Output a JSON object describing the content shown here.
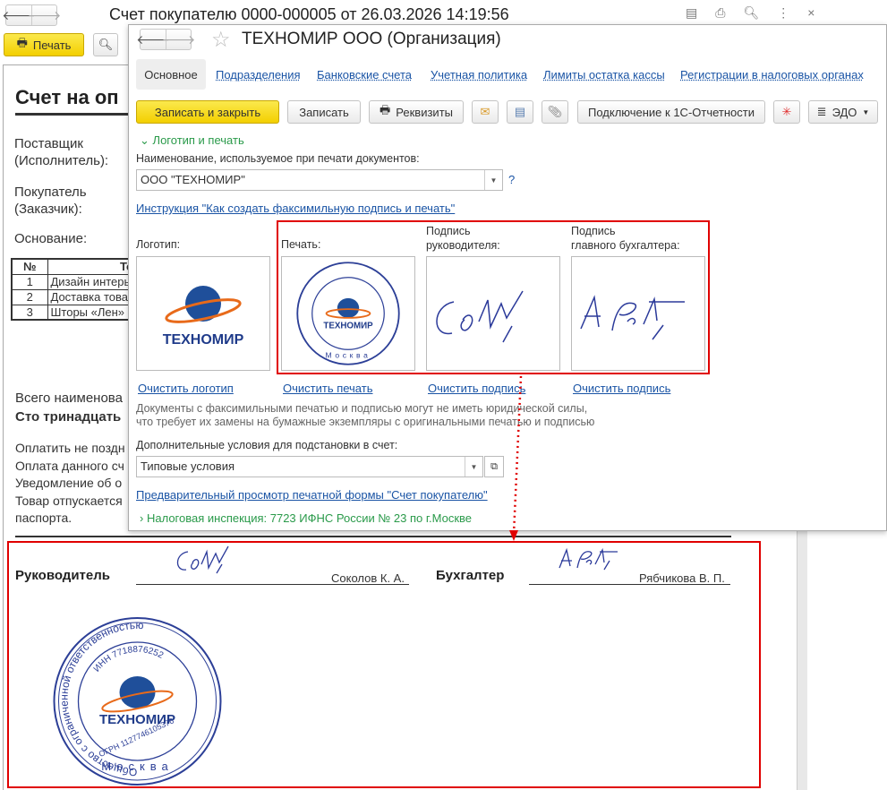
{
  "outer": {
    "title": "Счет покупателю 0000-000005 от 26.03.2026 14:19:56",
    "print_label": "Печать",
    "doc": {
      "heading": "Счет на оп",
      "supplier_label1": "Поставщик",
      "supplier_label2": "(Исполнитель):",
      "buyer_label1": "Покупатель",
      "buyer_label2": "(Заказчик):",
      "basis_label": "Основание:",
      "table_headers": [
        "№",
        "Тов"
      ],
      "rows": [
        [
          "1",
          "Дизайн интерь"
        ],
        [
          "2",
          "Доставка това"
        ],
        [
          "3",
          "Шторы «Лен»"
        ]
      ],
      "total_line": "Всего наименова",
      "total_words": "Сто тринадцать",
      "terms": [
        "Оплатить не поздн",
        "Оплата данного сч",
        "Уведомление об о",
        "Товар отпускается",
        "паспорта."
      ],
      "director_label": "Руководитель",
      "director_name": "Соколов К. А.",
      "accountant_label": "Бухгалтер",
      "accountant_name": "Рябчикова В. П."
    }
  },
  "stamp": {
    "org": "Общество с ограниченной ответственностью",
    "inn": "ИНН 7718876252",
    "ogrn": "ОГРН 1127746105376",
    "city": "Москва",
    "brand": "ТЕХНОМИР",
    "ooo": "ООО"
  },
  "org": {
    "title": "ТЕХНОМИР ООО (Организация)",
    "tabs": [
      "Основное",
      "Подразделения",
      "Банковские счета",
      "Учетная политика",
      "Лимиты остатка кассы",
      "Регистрации в налоговых органах"
    ],
    "toolbar": {
      "save_close": "Записать и закрыть",
      "save": "Записать",
      "requisites": "Реквизиты",
      "connect": "Подключение к 1С-Отчетности",
      "edo": "ЭДО"
    },
    "section_logo": "Логотип и печать",
    "name_label": "Наименование, используемое при печати документов:",
    "name_value": "ООО \"ТЕХНОМИР\"",
    "help": "?",
    "instruction_link": "Инструкция \"Как создать факсимильную подпись и печать\"",
    "logo_label": "Логотип:",
    "stamp_label": "Печать:",
    "dir_sign_label1": "Подпись",
    "dir_sign_label2": "руководителя:",
    "acc_sign_label1": "Подпись",
    "acc_sign_label2": "главного бухгалтера:",
    "clear_logo": "Очистить логотип",
    "clear_stamp": "Очистить печать",
    "clear_sign1": "Очистить подпись",
    "clear_sign2": "Очистить подпись",
    "note1": "Документы с факсимильными печатью и подписью могут не иметь юридической силы,",
    "note2": "что требует их замены на бумажные экземпляры с оригинальными печатью и подписью",
    "conditions_label": "Дополнительные условия для подстановки в счет:",
    "conditions_value": "Типовые условия",
    "preview_link": "Предварительный просмотр печатной формы \"Счет покупателю\"",
    "tax_section": "Налоговая инспекция: 7723 ИФНС России № 23 по г.Москве"
  },
  "colors": {
    "accent_red": "#e00000",
    "link": "#1a54a5",
    "green": "#2a9a4a",
    "yellow": "#f3cf00"
  }
}
